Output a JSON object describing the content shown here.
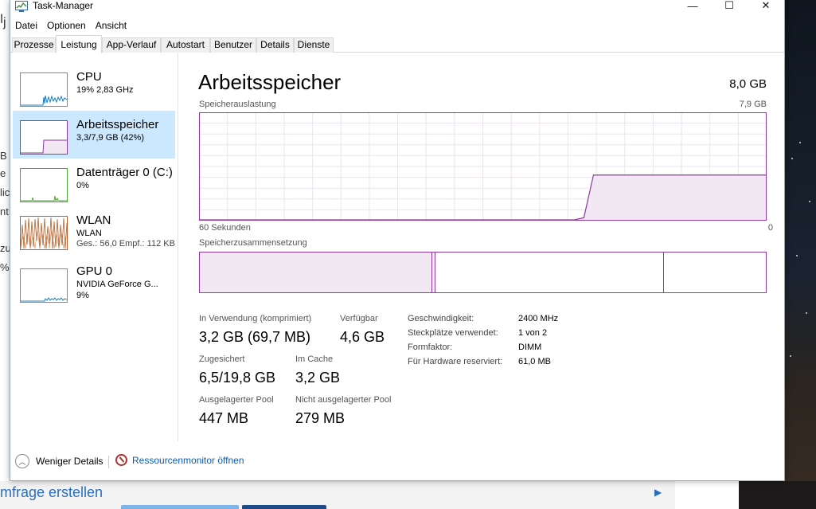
{
  "window": {
    "title": "Task-Manager",
    "controls": {
      "minimize": "—",
      "maximize": "☐",
      "close": "✕"
    }
  },
  "menu": [
    "Datei",
    "Optionen",
    "Ansicht"
  ],
  "tabs": [
    "Prozesse",
    "Leistung",
    "App-Verlauf",
    "Autostart",
    "Benutzer",
    "Details",
    "Dienste"
  ],
  "active_tab": "Leistung",
  "sidebar": {
    "items": [
      {
        "name": "CPU",
        "sub": "19%  2,83 GHz",
        "sub2": "",
        "color": "#1a7fc1"
      },
      {
        "name": "Arbeitsspeicher",
        "sub": "3,3/7,9 GB (42%)",
        "sub2": "",
        "color": "#8e3a9e"
      },
      {
        "name": "Datenträger 0 (C:)",
        "sub": "0%",
        "sub2": "",
        "color": "#4aa82c"
      },
      {
        "name": "WLAN",
        "sub": "WLAN",
        "sub2": "Ges.: 56,0  Empf.: 112 KB",
        "color": "#b3602a"
      },
      {
        "name": "GPU 0",
        "sub": "NVIDIA GeForce G...",
        "sub2": "9%",
        "color": "#1a7fc1"
      }
    ]
  },
  "main": {
    "title": "Arbeitsspeicher",
    "total": "8,0 GB",
    "usage_label": "Speicherauslastung",
    "usage_max": "7,9 GB",
    "time_left": "60 Sekunden",
    "time_right": "0",
    "composition_label": "Speicherzusammensetzung",
    "accent": "#8e3a9e",
    "usage_level": [
      0,
      0,
      0,
      0,
      0,
      0,
      0,
      0,
      0,
      0,
      0,
      0,
      0,
      0,
      0,
      0,
      0,
      0,
      0,
      0,
      0,
      0,
      0,
      0,
      0,
      0,
      0,
      0,
      0,
      0,
      0,
      0,
      0,
      0,
      0,
      0,
      0,
      0,
      0,
      0,
      0.02,
      0.42,
      0.42,
      0.42,
      0.42,
      0.42,
      0.42,
      0.42,
      0.42,
      0.42,
      0.42,
      0.42,
      0.42,
      0.42,
      0.42,
      0.42,
      0.42,
      0.42,
      0.42,
      0.42
    ],
    "composition": [
      {
        "part": "in-use",
        "fraction": 0.41
      },
      {
        "part": "modified",
        "fraction": 0.007
      },
      {
        "part": "standby",
        "fraction": 0.403
      },
      {
        "part": "free",
        "fraction": 0.18
      }
    ],
    "stats": [
      {
        "label": "In Verwendung (komprimiert)",
        "value": "3,2 GB (69,7 MB)"
      },
      {
        "label": "Verfügbar",
        "value": "4,6 GB"
      },
      {
        "label": "Zugesichert",
        "value": "6,5/19,8 GB"
      },
      {
        "label": "Im Cache",
        "value": "3,2 GB"
      },
      {
        "label": "Ausgelagerter Pool",
        "value": "447 MB"
      },
      {
        "label": "Nicht ausgelagerter Pool",
        "value": "279 MB"
      }
    ],
    "details": [
      {
        "label": "Geschwindigkeit:",
        "value": "2400 MHz"
      },
      {
        "label": "Steckplätze verwendet:",
        "value": "1 von 2"
      },
      {
        "label": "Formfaktor:",
        "value": "DIMM"
      },
      {
        "label": "Für Hardware reserviert:",
        "value": "61,0 MB"
      }
    ]
  },
  "footer": {
    "less_details": "Weniger Details",
    "resmon": "Ressourcenmonitor öffnen"
  },
  "background": {
    "left_chars": [
      "ǀ",
      "j",
      "B",
      "e",
      "lic",
      "nt",
      "zu",
      "%"
    ],
    "link": "mfrage erstellen",
    "arrow": "▶"
  }
}
